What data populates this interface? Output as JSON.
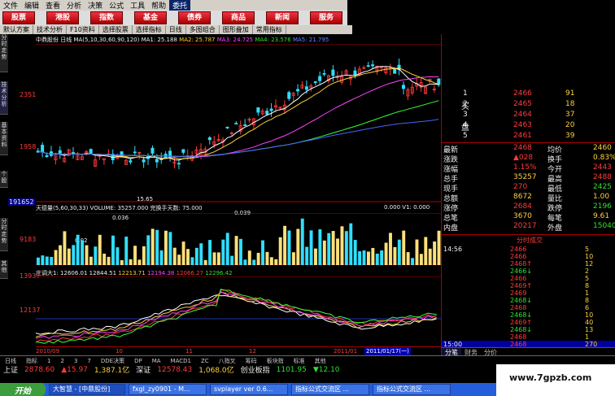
{
  "menu": [
    "文件",
    "编辑",
    "查看",
    "分析",
    "决策",
    "公式",
    "工具",
    "帮助",
    "委托"
  ],
  "nav": [
    "股票",
    "港股",
    "指数",
    "基金",
    "债券",
    "商品",
    "新闻",
    "服务"
  ],
  "toolbar": [
    "默认方案",
    "技术分析",
    "F10资料",
    "选择股票",
    "选择指标",
    "日线",
    "多图组合",
    "图形叠加",
    "常用指标"
  ],
  "lefttabs": [
    "分时走势",
    "技术分析",
    "基本资料",
    "个股",
    "分时走势",
    "其他"
  ],
  "kline": {
    "header": [
      "中鼎股份",
      "日线",
      "MA(5,10,30,60,90,120)",
      "MA1: 25.188",
      "MA2: 25.787",
      "MA3: 24.725",
      "MA4: 23.576",
      "MA5: 21.795"
    ],
    "yticks": [
      "2351",
      "1958"
    ],
    "annot_low": "15.65",
    "bottom_val": "191652",
    "colors": {
      "up": "#ff3b3b",
      "down": "#2fdfff",
      "ma1": "#ffffff",
      "ma2": "#ffd23a",
      "ma3": "#ff44ff",
      "ma4": "#3aff3a",
      "ma5": "#4466ff"
    }
  },
  "vol": {
    "header": [
      "天德量(5,60,30,33)",
      "VOLUME: 35257.000",
      "完换手天数: 75.000"
    ],
    "right": [
      "0.000",
      "V1: 0.000"
    ],
    "ytick": "9183",
    "labels": [
      "0.02",
      "0.036",
      "0.039"
    ]
  },
  "ind": {
    "header": [
      "庄调大1: 12606.01",
      "12844.51",
      "12213.71",
      "12194.38",
      "12066.27",
      "12296.42"
    ],
    "yticks": [
      "13937",
      "12137"
    ],
    "xlabels": [
      "2010/09",
      "10",
      "11",
      "12",
      "2011/01",
      "2011/01/17(一)"
    ]
  },
  "quote": {
    "asks": [
      [
        "2466",
        "91"
      ],
      [
        "2465",
        "18"
      ],
      [
        "2464",
        "37"
      ],
      [
        "2463",
        "20"
      ],
      [
        "2461",
        "39"
      ]
    ],
    "ask_labels": [
      "1",
      "2",
      "3",
      "4",
      "5"
    ],
    "side_labels": [
      "买",
      "盘"
    ],
    "rows": [
      [
        "最新",
        "2468",
        "均价",
        "2460"
      ],
      [
        "涨跌",
        "▲028",
        "换手",
        "0.83%"
      ],
      [
        "涨幅",
        "1.15%",
        "今开",
        "2443"
      ],
      [
        "总手",
        "35257",
        "最高",
        "2488"
      ],
      [
        "现手",
        "270",
        "最低",
        "2425"
      ],
      [
        "总额",
        "8672",
        "量比",
        "1.00"
      ],
      [
        "涨停",
        "2684",
        "跌停",
        "2196"
      ],
      [
        "总笔",
        "3670",
        "每笔",
        "9.61"
      ],
      [
        "内盘",
        "20217",
        "外盘",
        "15040"
      ]
    ],
    "ticks_title": "分时成交",
    "ticks": [
      [
        "14:56",
        "2466",
        "5"
      ],
      [
        "",
        "2466",
        "10"
      ],
      [
        "",
        "2468↑",
        "12"
      ],
      [
        "",
        "2466↓",
        "2"
      ],
      [
        "",
        "2466",
        "5"
      ],
      [
        "",
        "2469↑",
        "8"
      ],
      [
        "",
        "2469",
        "1"
      ],
      [
        "",
        "2468↓",
        "8"
      ],
      [
        "",
        "2468",
        "6"
      ],
      [
        "",
        "2468↓",
        "10"
      ],
      [
        "",
        "2469↑",
        "40"
      ],
      [
        "",
        "2468↓",
        "13"
      ],
      [
        "",
        "2468",
        "1"
      ],
      [
        "15:00",
        "2468",
        "270"
      ]
    ],
    "bottom_tabs": [
      "分笔",
      "财务",
      "分价"
    ]
  },
  "bottomtabs": [
    "日线",
    "指标",
    "1",
    "2",
    "3",
    "7",
    "DDE决策",
    "DP",
    "MA",
    "MACD1",
    "ZC",
    "八指叉",
    "筹码",
    "板块指",
    "标准",
    "其他"
  ],
  "status": [
    "上证",
    "2878.60",
    "▲15.97",
    "1,387.1亿",
    "深证",
    "12578.43",
    "1,068.0亿",
    "创业板指",
    "1101.95",
    "▼12.10"
  ],
  "taskbar": {
    "start": "开始",
    "tasks": [
      "大智慧 - [中鼎股份]",
      "fxgl_zy0901 - M...",
      "svplayer ver 0.6...",
      "指标公式交流区 ...",
      "指标公式交流区 ..."
    ]
  },
  "watermark": "www.7gpzb.com"
}
